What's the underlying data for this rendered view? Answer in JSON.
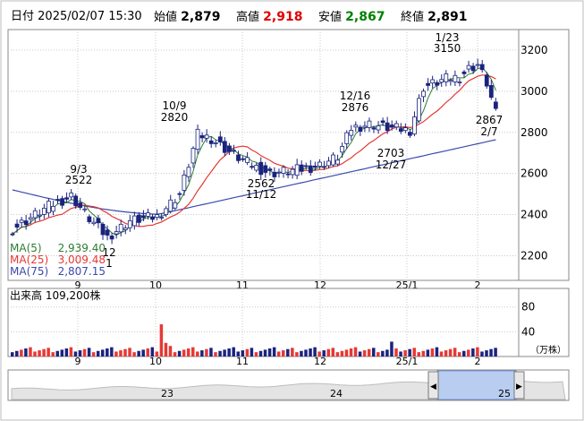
{
  "header": {
    "date_label": "日付",
    "datetime": "2025/02/07 15:30",
    "open_label": "始値",
    "open_value": "2,879",
    "high_label": "高値",
    "high_value": "2,918",
    "low_label": "安値",
    "low_value": "2,867",
    "close_label": "終値",
    "close_value": "2,891",
    "colors": {
      "high": "#e00000",
      "low": "#008000"
    }
  },
  "chart_data": [
    {
      "type": "candlestick",
      "title": "",
      "price_axis": {
        "ticks": [
          2200,
          2400,
          2600,
          2800,
          3000,
          3200
        ],
        "ylim": [
          2080,
          3300
        ]
      },
      "x_ticks": [
        "9",
        "10",
        "11",
        "12",
        "25/1",
        "2"
      ],
      "annotations": [
        {
          "date": "9/3",
          "value": 2522,
          "text_lines": [
            "9/3",
            "2522"
          ]
        },
        {
          "date": "10/9",
          "value": 2820,
          "text_lines": [
            "10/9",
            "2820"
          ]
        },
        {
          "date": "11/12",
          "value": 2562,
          "text_lines": [
            "2562",
            "11/12"
          ]
        },
        {
          "date": "12/16",
          "value": 2876,
          "text_lines": [
            "12/16",
            "2876"
          ]
        },
        {
          "date": "12/27",
          "value": 2703,
          "text_lines": [
            "2703",
            "12/27"
          ]
        },
        {
          "date": "1/23",
          "value": 3150,
          "text_lines": [
            "1/23",
            "3150"
          ]
        },
        {
          "date": "2/7",
          "value": 2867,
          "text_lines": [
            "2867",
            "2/7"
          ]
        }
      ],
      "edge_labels": [
        "12",
        "1"
      ],
      "legend": [
        {
          "name": "MA(5)",
          "value": "2,939.40",
          "color": "#2e7d32"
        },
        {
          "name": "MA(25)",
          "value": "3,009.48",
          "color": "#e53935"
        },
        {
          "name": "MA(75)",
          "value": "2,807.15",
          "color": "#3949ab"
        }
      ],
      "colors": {
        "up": "#ffffff",
        "down": "#1a237e",
        "outline": "#1a237e"
      }
    },
    {
      "type": "bar",
      "title": "出来高",
      "legend_value": "109,200株",
      "y_ticks": [
        40,
        80
      ],
      "ylim": [
        0,
        110
      ],
      "unit": "（万株）",
      "x_ticks": [
        "9",
        "10",
        "11",
        "12",
        "25/1",
        "2"
      ],
      "colors": {
        "up": "#e53935",
        "down": "#1a237e"
      }
    }
  ],
  "navigator": {
    "labels": [
      "23",
      "24",
      "25"
    ],
    "left_arrow": "◀",
    "right_arrow": "▶"
  }
}
